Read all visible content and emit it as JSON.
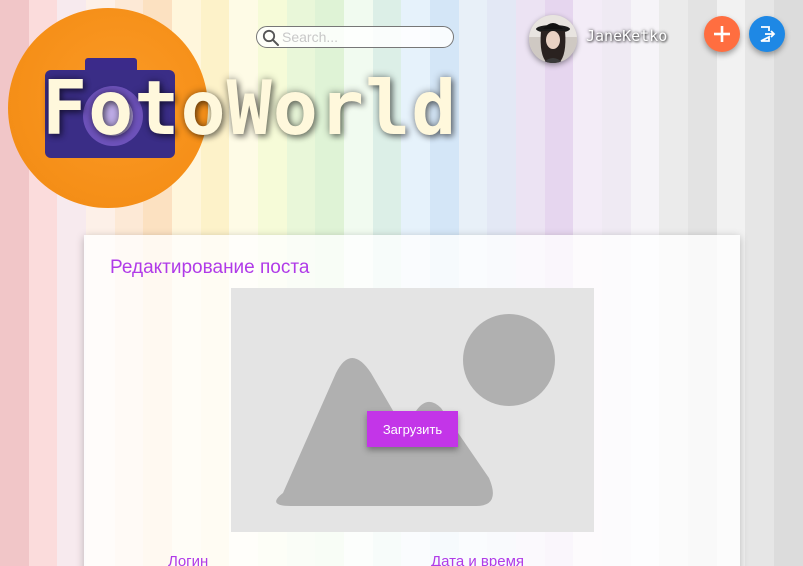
{
  "header": {
    "logo_text": "FotoWorld",
    "search": {
      "placeholder": "Search...",
      "value": ""
    },
    "user": {
      "name": "JaneKetko"
    },
    "add_icon": "plus-icon",
    "logout_icon": "logout-icon"
  },
  "edit_post": {
    "title": "Редактирование поста",
    "upload_label": "Загрузить",
    "fields": {
      "login_label": "Логин",
      "datetime_label": "Дата и время"
    }
  },
  "colors": {
    "accent": "#b03be8",
    "upload_button": "#c335e8",
    "add_button": "#ff6e40",
    "logout_button": "#1e88e5",
    "logo_circle": "#f69019",
    "logo_text": "#fff8dc"
  }
}
